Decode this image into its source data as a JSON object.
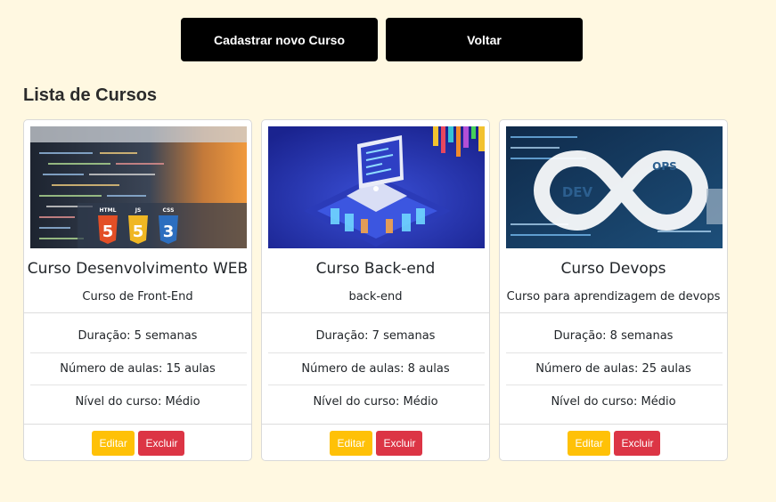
{
  "header": {
    "add_label": "Cadastrar novo Curso",
    "back_label": "Voltar"
  },
  "list_title": "Lista de Cursos",
  "courses": [
    {
      "title": "Curso Desenvolvimento WEB",
      "description": "Curso de Front-End",
      "duration": "Duração: 5 semanas",
      "lessons": "Número de aulas: 15 aulas",
      "level": "Nível do curso: Médio",
      "edit_label": "Editar",
      "delete_label": "Excluir",
      "image_icon": "html5-js-css3-image",
      "badges": [
        "HTML",
        "JS",
        "CSS"
      ]
    },
    {
      "title": "Curso Back-end",
      "description": "back-end",
      "duration": "Duração: 7 semanas",
      "lessons": "Número de aulas: 8 aulas",
      "level": "Nível do curso: Médio",
      "edit_label": "Editar",
      "delete_label": "Excluir",
      "image_icon": "server-laptop-image"
    },
    {
      "title": "Curso Devops",
      "description": "Curso para aprendizagem de devops",
      "duration": "Duração: 8 semanas",
      "lessons": "Número de aulas: 25 aulas",
      "level": "Nível do curso: Médio",
      "edit_label": "Editar",
      "delete_label": "Excluir",
      "image_icon": "devops-infinity-image",
      "badges": [
        "DEV",
        "OPS"
      ]
    }
  ],
  "colors": {
    "page_bg": "#fff8e1",
    "edit": "#ffc107",
    "delete": "#dc3545",
    "header_button": "#000000"
  }
}
